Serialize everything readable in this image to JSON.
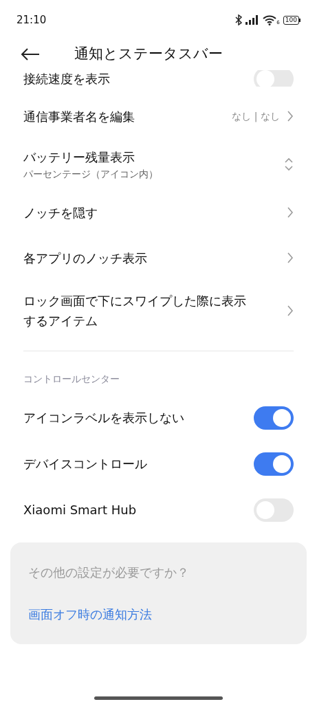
{
  "status_bar": {
    "time": "21:10",
    "network_badge": "6",
    "battery": "100"
  },
  "header": {
    "title": "通知とステータスバー"
  },
  "partial_row": {
    "label": "接続速度を表示",
    "on": false
  },
  "items": [
    {
      "kind": "link",
      "label": "通信事業者名を編集",
      "value": "なし | なし"
    },
    {
      "kind": "select",
      "label": "バッテリー残量表示",
      "subtitle": "パーセンテージ（アイコン内）"
    },
    {
      "kind": "link",
      "label": "ノッチを隠す"
    },
    {
      "kind": "link",
      "label": "各アプリのノッチ表示"
    },
    {
      "kind": "link",
      "label": "ロック画面で下にスワイプした際に表示するアイテム"
    }
  ],
  "section": {
    "title": "コントロールセンター",
    "toggles": [
      {
        "label": "アイコンラベルを表示しない",
        "on": true
      },
      {
        "label": "デバイスコントロール",
        "on": true
      },
      {
        "label": "Xiaomi Smart Hub",
        "on": false
      }
    ]
  },
  "card": {
    "question": "その他の設定が必要ですか？",
    "link": "画面オフ時の通知方法"
  }
}
